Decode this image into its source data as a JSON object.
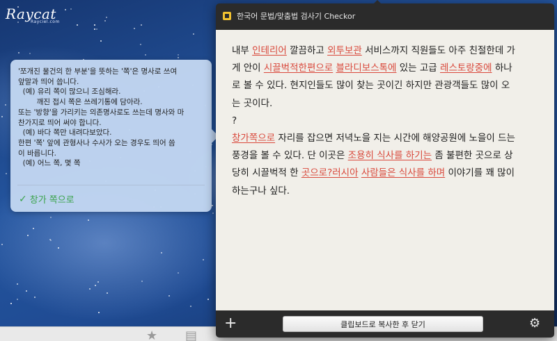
{
  "desktop": {
    "logo": "Raycat",
    "logo_sub": "Rayciel.com"
  },
  "tooltip": {
    "lines": [
      "'쪼개진 물건의 한 부분'을 뜻하는 '쪽'은 명사로 쓰여",
      "앞말과 띄어 씁니다.",
      "  (예) 유리 쪽이 많으니 조심해라.",
      "        깨진 접시 쪽은 쓰레기통에 담아라.",
      "또는 '방향'을 가리키는 의존명사로도 쓰는데 명사와 마",
      "찬가지로 띄어 써야 합니다.",
      "  (예) 바다 쪽만 내려다보았다.",
      "한편 '쪽' 앞에 관형사나 수사가 오는 경우도 띄어 씀",
      "이 바릅니다.",
      "  (예) 어느 쪽, 몇 쪽"
    ],
    "suggestion_check": "✓",
    "suggestion_label": "창가 쪽으로"
  },
  "window": {
    "title": "한국어 문법/맞춤법 검사기 Checkor",
    "lines": [
      [
        {
          "t": "내부 "
        },
        {
          "t": "인테리어",
          "e": true
        },
        {
          "t": " 깔끔하고 "
        },
        {
          "t": "외투보관",
          "e": true
        },
        {
          "t": " 서비스까지 직원들도 아주 친절한데 가"
        }
      ],
      [
        {
          "t": "게 안이 "
        },
        {
          "t": "시끌벅적한편으로",
          "e": true
        },
        {
          "t": " "
        },
        {
          "t": "블라디보스톡에",
          "e": true
        },
        {
          "t": " 있는 고급 "
        },
        {
          "t": "레스토랑중에",
          "e": true
        },
        {
          "t": " 하나"
        }
      ],
      [
        {
          "t": "로 볼 수 있다. 현지인들도 많이 찾는 곳이긴 하지만 관광객들도 많이 오"
        }
      ],
      [
        {
          "t": "는 곳이다."
        }
      ],
      [
        {
          "t": "?"
        }
      ],
      [
        {
          "t": "창가쪽으로",
          "e": true
        },
        {
          "t": " 자리를 잡으면 저녁노을 지는 시간에 해양공원에 노을이 드는"
        }
      ],
      [
        {
          "t": "풍경을 볼 수 있다. 단 이곳은 "
        },
        {
          "t": "조용히 식사를 하기는",
          "e": true
        },
        {
          "t": " 좀 불편한 곳으로 상"
        }
      ],
      [
        {
          "t": "당히 시끌벅적 한 "
        },
        {
          "t": "곳으로?러시아",
          "e": true
        },
        {
          "t": " "
        },
        {
          "t": "사람들은 식사를 하며",
          "e": true
        },
        {
          "t": " 이야기를 꽤 많이"
        }
      ],
      [
        {
          "t": "하는구나 싶다."
        }
      ]
    ],
    "footer": {
      "plus_icon": "+",
      "copy_button": "클립보드로 복사한 후 닫기",
      "gear_icon": "⚙"
    }
  },
  "colors": {
    "error": "#d9483b",
    "suggestion": "#3aa34a",
    "window_bg": "#2b2b2b",
    "content_bg": "#f1efe9",
    "tooltip_bg": "#c1d6f1"
  }
}
